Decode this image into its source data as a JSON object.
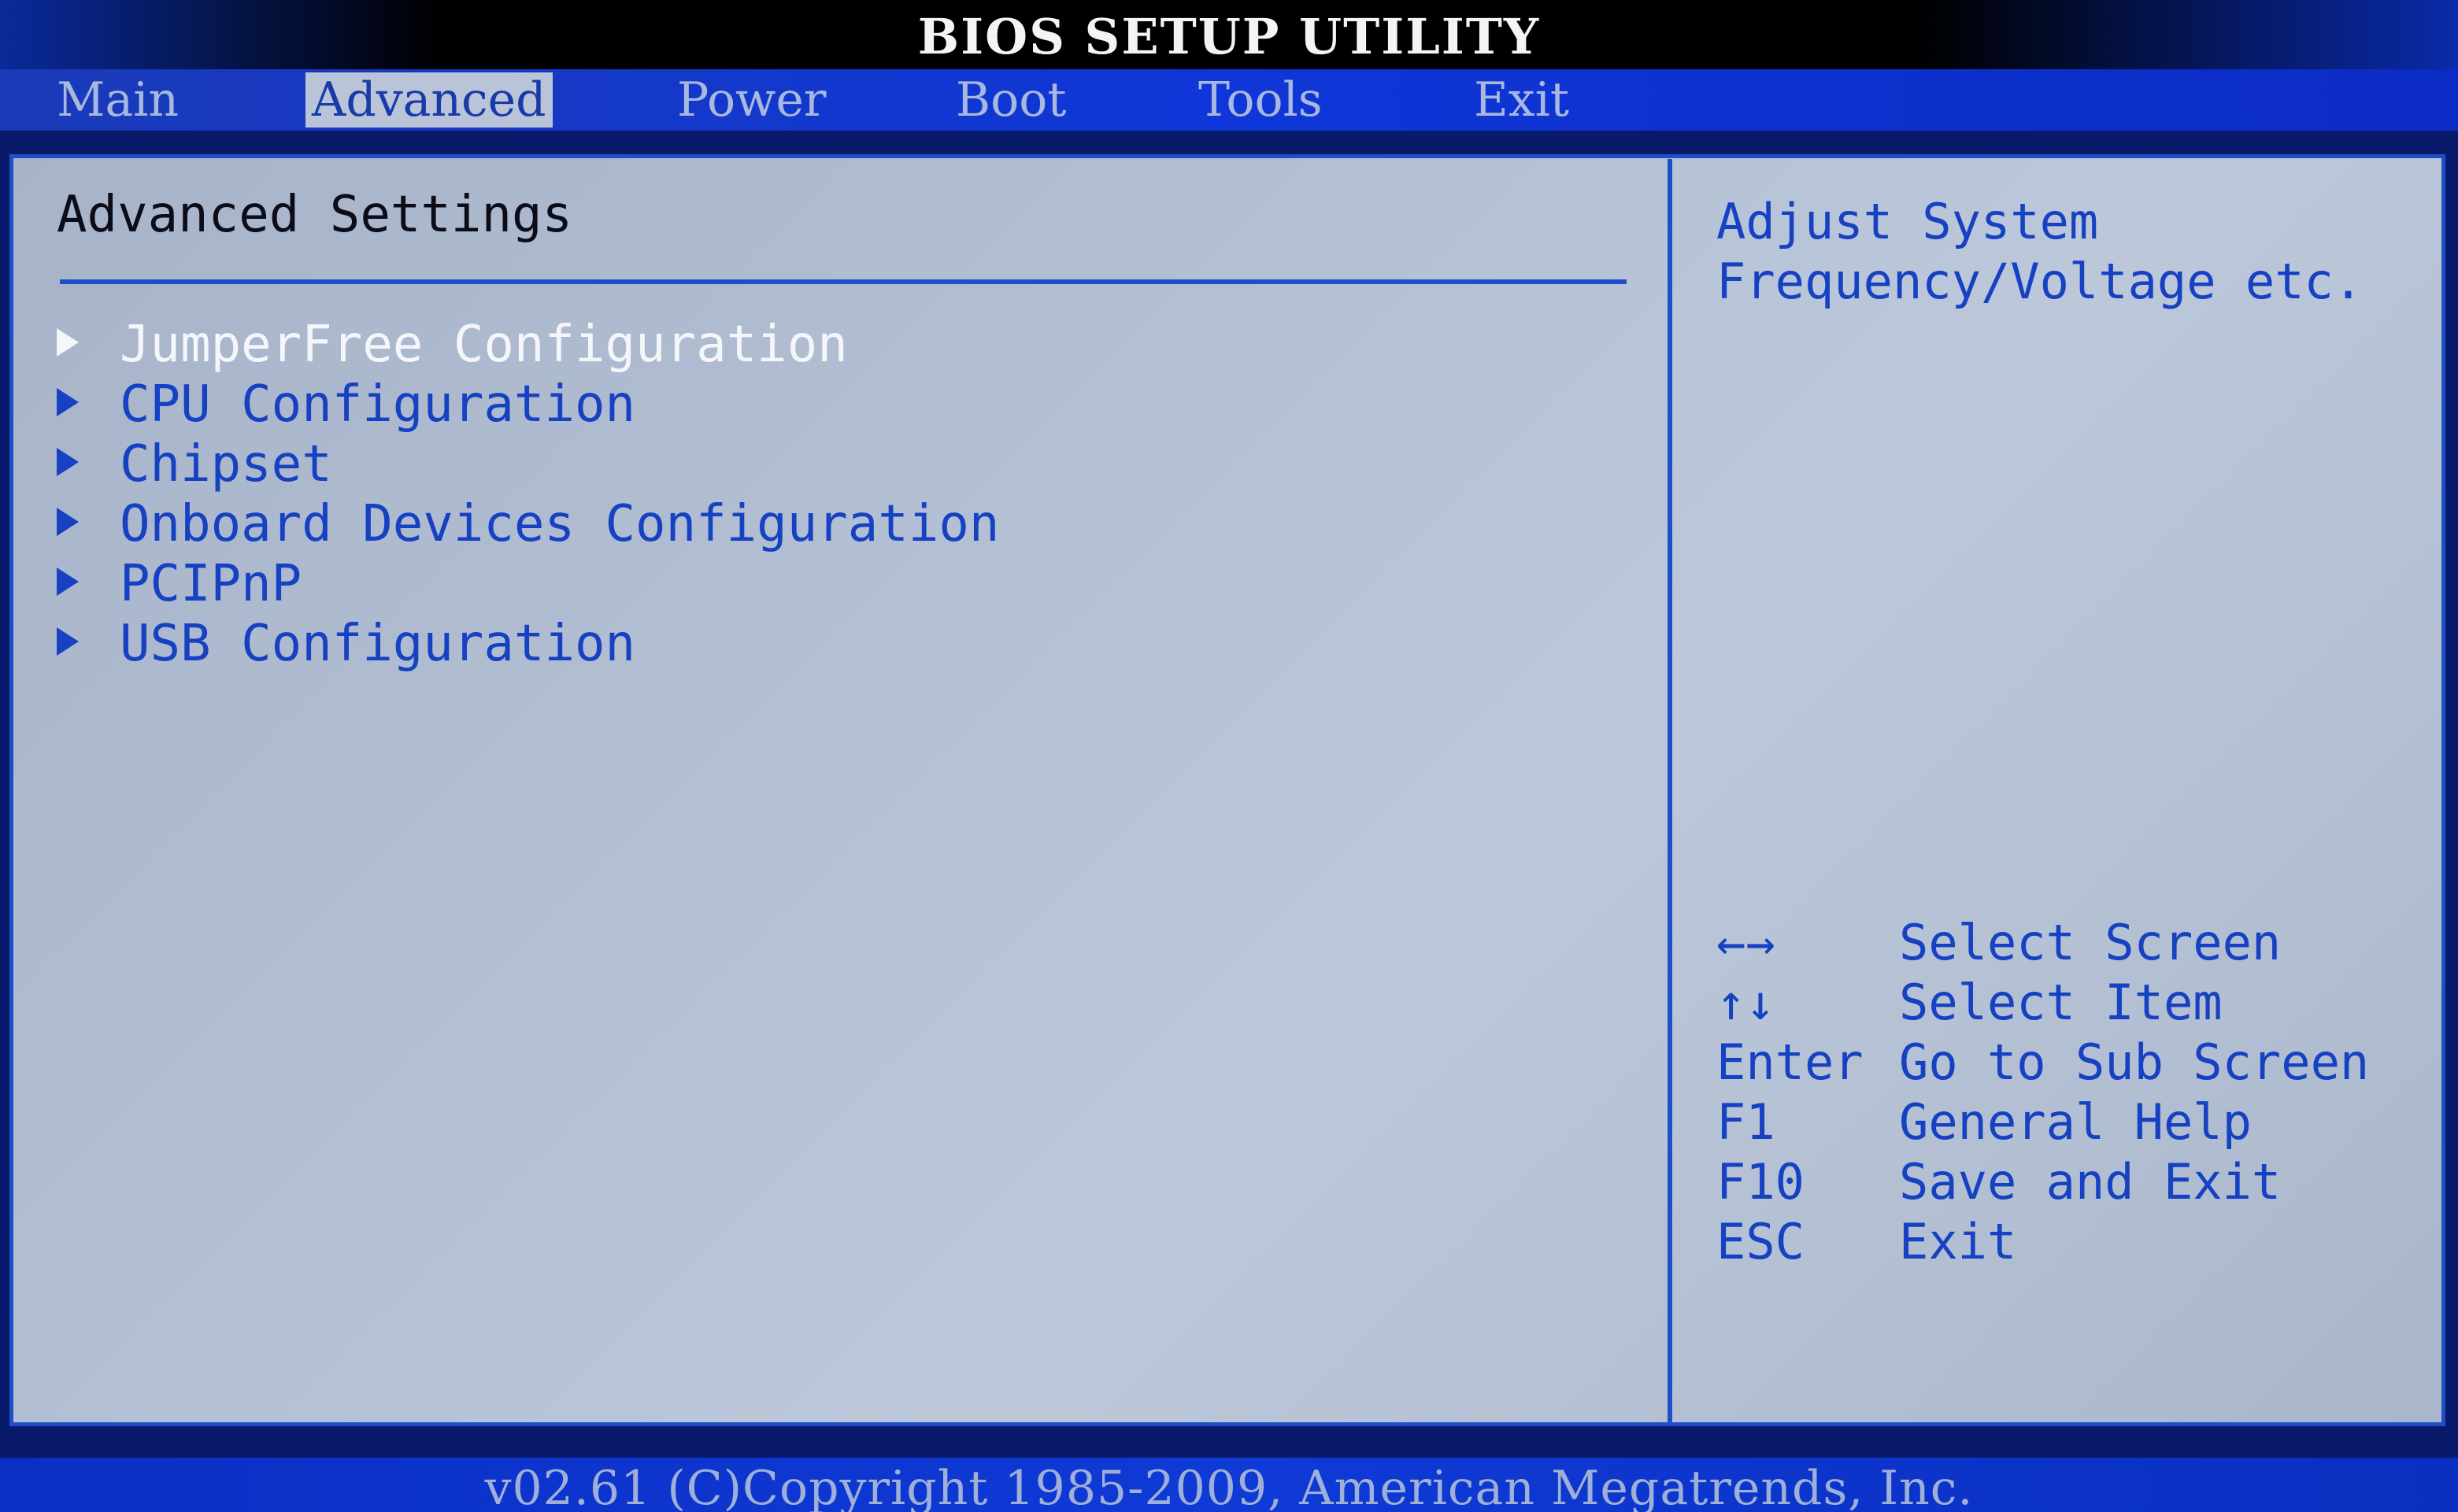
{
  "title": "BIOS SETUP UTILITY",
  "menu": {
    "tabs": [
      {
        "label": "Main"
      },
      {
        "label": "Advanced"
      },
      {
        "label": "Power"
      },
      {
        "label": "Boot"
      },
      {
        "label": "Tools"
      },
      {
        "label": "Exit"
      }
    ],
    "active_tab": "Advanced"
  },
  "main": {
    "section_title": "Advanced Settings",
    "items": [
      {
        "label": "JumperFree Configuration"
      },
      {
        "label": "CPU Configuration"
      },
      {
        "label": "Chipset"
      },
      {
        "label": "Onboard Devices Configuration"
      },
      {
        "label": "PCIPnP"
      },
      {
        "label": "USB Configuration"
      }
    ],
    "selected_item": "JumperFree Configuration"
  },
  "help": {
    "line1": "Adjust System",
    "line2": "Frequency/Voltage etc."
  },
  "keys": [
    {
      "key": "←→",
      "desc": "Select Screen"
    },
    {
      "key": "↑↓",
      "desc": "Select Item"
    },
    {
      "key": "Enter",
      "desc": "Go to Sub Screen"
    },
    {
      "key": "F1",
      "desc": "General Help"
    },
    {
      "key": "F10",
      "desc": "Save and Exit"
    },
    {
      "key": "ESC",
      "desc": "Exit"
    }
  ],
  "footer": "v02.61 (C)Copyright 1985-2009, American Megatrends, Inc.",
  "colors": {
    "accent_blue": "#1f4fc8",
    "text_blue": "#1541c2",
    "panel_gray": "#b6c2d6",
    "selected_text": "#f4f6fa"
  }
}
